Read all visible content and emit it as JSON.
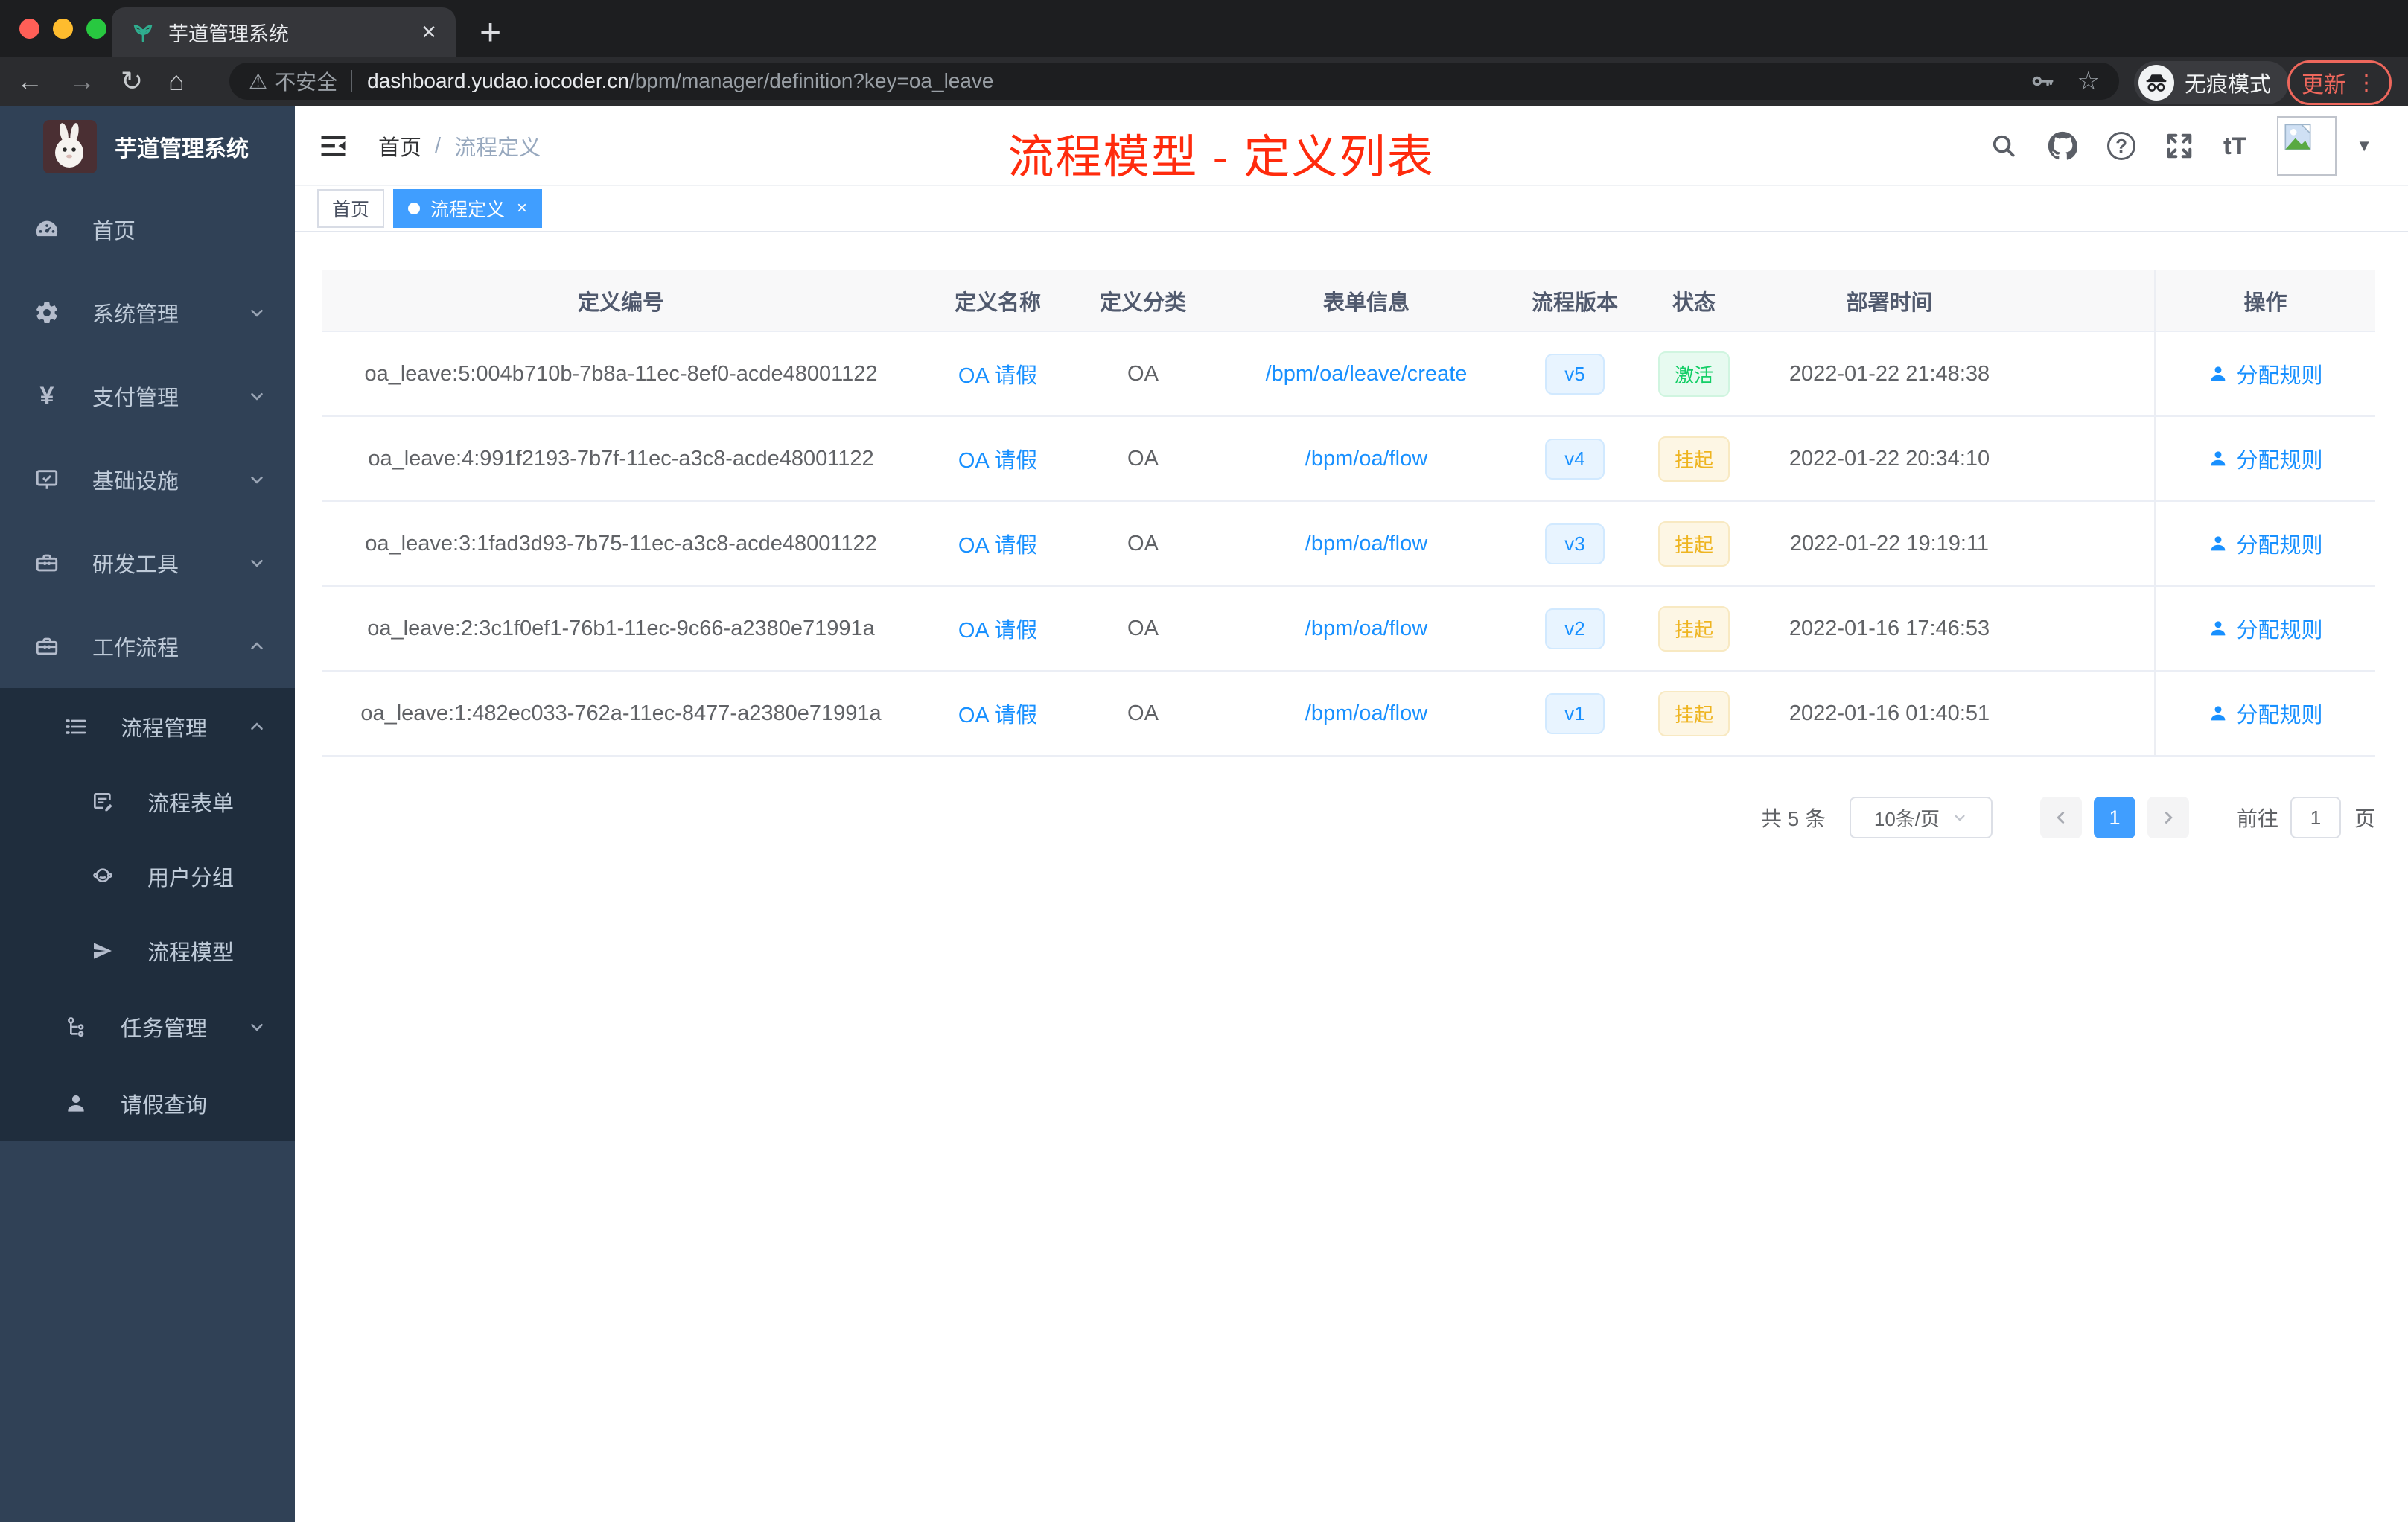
{
  "browser": {
    "tab_title": "芋道管理系统",
    "not_secure_label": "不安全",
    "url_host": "dashboard.yudao.iocoder.cn",
    "url_path": "/bpm/manager/definition?key=oa_leave",
    "incognito_label": "无痕模式",
    "update_label": "更新"
  },
  "icons": {
    "back": "←",
    "forward": "→",
    "reload": "↻",
    "home": "⌂",
    "warning": "⚠",
    "star": "☆",
    "menu_dots": "⋮",
    "plus": "+",
    "close": "×",
    "question": "?",
    "font_size": "tT",
    "caret_down": "▼",
    "yen": "¥",
    "slash": "/",
    "dot": ""
  },
  "header": {
    "breadcrumb": [
      "首页",
      "流程定义"
    ],
    "annotation": "流程模型 - 定义列表"
  },
  "tags": [
    {
      "label": "首页"
    },
    {
      "label": "流程定义"
    }
  ],
  "sidebar": {
    "logo_title": "芋道管理系统",
    "items": [
      {
        "label": "首页",
        "icon": "dashboard-icon"
      },
      {
        "label": "系统管理",
        "icon": "gear-icon"
      },
      {
        "label": "支付管理",
        "icon": "yen-icon"
      },
      {
        "label": "基础设施",
        "icon": "monitor-icon"
      },
      {
        "label": "研发工具",
        "icon": "toolbox-icon"
      },
      {
        "label": "工作流程",
        "icon": "toolbox-icon"
      },
      {
        "label": "流程管理",
        "icon": "tree-table-icon"
      },
      {
        "label": "流程表单",
        "icon": "form-icon"
      },
      {
        "label": "用户分组",
        "icon": "people-icon"
      },
      {
        "label": "流程模型",
        "icon": "send-icon"
      },
      {
        "label": "任务管理",
        "icon": "org-tree-icon"
      },
      {
        "label": "请假查询",
        "icon": "user-icon"
      }
    ]
  },
  "table": {
    "columns": [
      "定义编号",
      "定义名称",
      "定义分类",
      "表单信息",
      "流程版本",
      "状态",
      "部署时间",
      "操作"
    ],
    "rows": [
      {
        "id": "oa_leave:5:004b710b-7b8a-11ec-8ef0-acde48001122",
        "name": "OA 请假",
        "category": "OA",
        "form": "/bpm/oa/leave/create",
        "version": "v5",
        "status": "激活",
        "status_type": "active",
        "deploy_time": "2022-01-22 21:48:38",
        "action": "分配规则"
      },
      {
        "id": "oa_leave:4:991f2193-7b7f-11ec-a3c8-acde48001122",
        "name": "OA 请假",
        "category": "OA",
        "form": "/bpm/oa/flow",
        "version": "v4",
        "status": "挂起",
        "status_type": "suspended",
        "deploy_time": "2022-01-22 20:34:10",
        "action": "分配规则"
      },
      {
        "id": "oa_leave:3:1fad3d93-7b75-11ec-a3c8-acde48001122",
        "name": "OA 请假",
        "category": "OA",
        "form": "/bpm/oa/flow",
        "version": "v3",
        "status": "挂起",
        "status_type": "suspended",
        "deploy_time": "2022-01-22 19:19:11",
        "action": "分配规则"
      },
      {
        "id": "oa_leave:2:3c1f0ef1-76b1-11ec-9c66-a2380e71991a",
        "name": "OA 请假",
        "category": "OA",
        "form": "/bpm/oa/flow",
        "version": "v2",
        "status": "挂起",
        "status_type": "suspended",
        "deploy_time": "2022-01-16 17:46:53",
        "action": "分配规则"
      },
      {
        "id": "oa_leave:1:482ec033-762a-11ec-8477-a2380e71991a",
        "name": "OA 请假",
        "category": "OA",
        "form": "/bpm/oa/flow",
        "version": "v1",
        "status": "挂起",
        "status_type": "suspended",
        "deploy_time": "2022-01-16 01:40:51",
        "action": "分配规则"
      }
    ]
  },
  "pagination": {
    "total_label": "共 5 条",
    "page_size": "10条/页",
    "current_page": "1",
    "goto_label": "前往",
    "goto_value": "1",
    "unit_label": "页"
  },
  "colors": {
    "accent_blue": "#409eff",
    "link_blue": "#1890ff",
    "active_green": "#13ce66",
    "suspended_yellow": "#eeb420",
    "annotation_red": "#ff2b0d",
    "sidebar_bg": "#304156",
    "submenu_bg": "#1f2d3d",
    "traffic_red": "#ff5f57",
    "traffic_yellow": "#febc2e",
    "traffic_green": "#28c840"
  }
}
